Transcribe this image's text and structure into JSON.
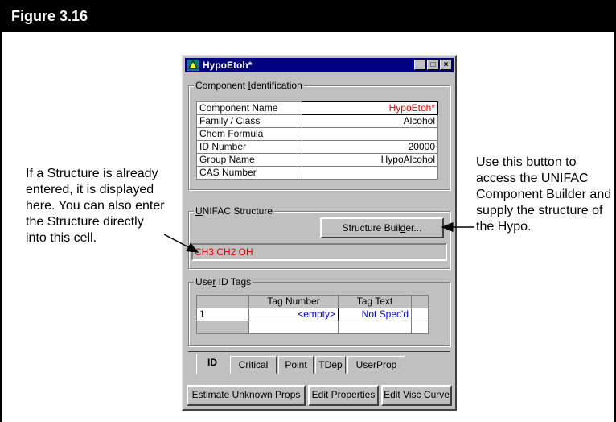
{
  "figure": {
    "title": "Figure 3.16"
  },
  "captions": {
    "left": "If a Structure is already entered, it is displayed here. You can also enter the Structure directly into this cell.",
    "right": "Use this button to access the UNIFAC Component Builder and supply the structure of the Hypo."
  },
  "window": {
    "title": "HypoEtoh*",
    "buttons": {
      "minimize": "_",
      "maximize": "□",
      "close": "×"
    }
  },
  "component_identification": {
    "legend_pre": "Component ",
    "legend_u": "I",
    "legend_post": "dentification",
    "rows": [
      {
        "label": "Component Name",
        "value": "HypoEtoh*"
      },
      {
        "label": "Family / Class",
        "value": "Alcohol"
      },
      {
        "label": "Chem Formula",
        "value": ""
      },
      {
        "label": "ID Number",
        "value": "20000"
      },
      {
        "label": "Group Name",
        "value": "HypoAlcohol"
      },
      {
        "label": "CAS Number",
        "value": ""
      }
    ]
  },
  "unifac": {
    "legend_u": "U",
    "legend_post": "NIFAC Structure",
    "builder_pre": "Structure Buil",
    "builder_u": "d",
    "builder_post": "er...",
    "structure": "CH3 CH2 OH"
  },
  "user_id_tags": {
    "legend_pre": "Use",
    "legend_u": "r",
    "legend_post": " ID Tags",
    "headers": [
      "Tag Number",
      "Tag Text"
    ],
    "rows": [
      {
        "index": "1",
        "tag_number": "<empty>",
        "tag_text": "Not Spec'd"
      }
    ]
  },
  "tabs": [
    "ID",
    "Critical",
    "Point",
    "TDep",
    "UserProp"
  ],
  "actions": {
    "estimate_u": "E",
    "estimate_post": "stimate Unknown Props",
    "edit_props_pre": "Edit ",
    "edit_props_u": "P",
    "edit_props_post": "roperties",
    "edit_visc_pre": "Edit Visc ",
    "edit_visc_u": "C",
    "edit_visc_post": "urve"
  }
}
